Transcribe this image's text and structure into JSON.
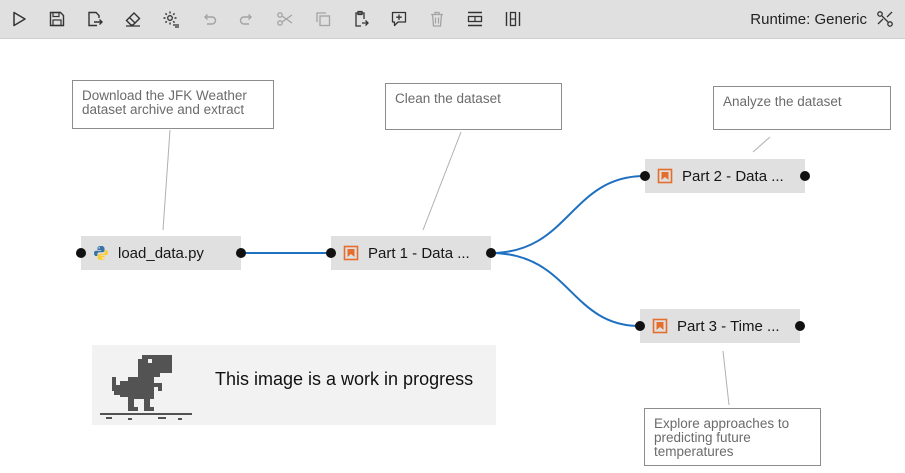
{
  "toolbar": {
    "buttons": [
      {
        "name": "run-pipeline-button",
        "icon": "play-icon",
        "disabled": false
      },
      {
        "name": "save-pipeline-button",
        "icon": "save-icon",
        "disabled": false
      },
      {
        "name": "export-pipeline-button",
        "icon": "export-icon",
        "disabled": false
      },
      {
        "name": "clear-pipeline-button",
        "icon": "eraser-icon",
        "disabled": false
      },
      {
        "name": "pipeline-settings-button",
        "icon": "settings-icon",
        "disabled": false
      },
      {
        "name": "undo-button",
        "icon": "undo-icon",
        "disabled": true
      },
      {
        "name": "redo-button",
        "icon": "redo-icon",
        "disabled": true
      },
      {
        "name": "cut-button",
        "icon": "cut-icon",
        "disabled": true
      },
      {
        "name": "copy-button",
        "icon": "copy-icon",
        "disabled": true
      },
      {
        "name": "paste-button",
        "icon": "paste-icon",
        "disabled": false
      },
      {
        "name": "add-comment-button",
        "icon": "comment-icon",
        "disabled": false
      },
      {
        "name": "delete-button",
        "icon": "trash-icon",
        "disabled": true
      },
      {
        "name": "arrange-horizontal-button",
        "icon": "arrange-horizontal-icon",
        "disabled": false
      },
      {
        "name": "arrange-vertical-button",
        "icon": "arrange-vertical-icon",
        "disabled": false
      }
    ],
    "runtime_label": "Runtime: Generic"
  },
  "comments": {
    "download": "Download the JFK Weather dataset archive and extract",
    "clean": "Clean the dataset",
    "analyze": "Analyze the dataset",
    "explore": "Explore approaches to predicting future temperatures"
  },
  "nodes": {
    "load_data": "load_data.py",
    "part1": "Part 1 - Data ...",
    "part2": "Part 2 - Data ...",
    "part3": "Part 3 - Time ..."
  },
  "wip_banner": {
    "text": "This image is a work in progress"
  },
  "colors": {
    "link": "#1f70c1",
    "notebook_icon": "#e46e2e",
    "python_blue": "#3872a6",
    "python_yellow": "#f7cf3d"
  }
}
